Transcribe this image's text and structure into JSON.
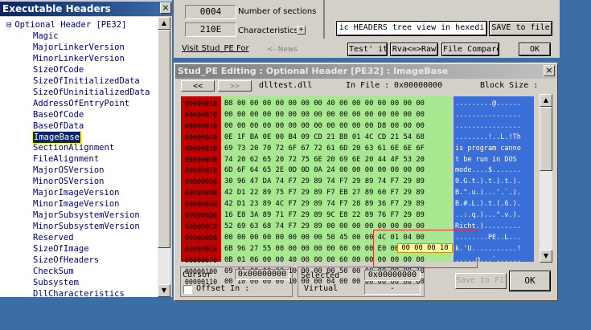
{
  "tree_window": {
    "title": "Executable Headers",
    "close": "×",
    "items": [
      {
        "prefix": "⊟",
        "label": "Optional Header [PE32]"
      },
      {
        "prefix": "",
        "label": "Magic"
      },
      {
        "prefix": "",
        "label": "MajorLinkerVersion"
      },
      {
        "prefix": "",
        "label": "MinorLinkerVersion"
      },
      {
        "prefix": "",
        "label": "SizeOfCode"
      },
      {
        "prefix": "",
        "label": "SizeOfInitializedData"
      },
      {
        "prefix": "",
        "label": "SizeOfUninitializedData"
      },
      {
        "prefix": "",
        "label": "AddressOfEntryPoint"
      },
      {
        "prefix": "",
        "label": "BaseOfCode"
      },
      {
        "prefix": "",
        "label": "BaseOfData"
      },
      {
        "prefix": "",
        "label": "ImageBase",
        "selected": true
      },
      {
        "prefix": "",
        "label": "SectionAlignment"
      },
      {
        "prefix": "",
        "label": "FileAlignment"
      },
      {
        "prefix": "",
        "label": "MajorOSVersion"
      },
      {
        "prefix": "",
        "label": "MinorOSVersion"
      },
      {
        "prefix": "",
        "label": "MajorImageVersion"
      },
      {
        "prefix": "",
        "label": "MinorImageVersion"
      },
      {
        "prefix": "",
        "label": "MajorSubsystemVersion"
      },
      {
        "prefix": "",
        "label": "MinorSubsystemVersion"
      },
      {
        "prefix": "",
        "label": "Reserved"
      },
      {
        "prefix": "",
        "label": "SizeOfImage"
      },
      {
        "prefix": "",
        "label": "SizeOfHeaders"
      },
      {
        "prefix": "",
        "label": "CheckSum"
      },
      {
        "prefix": "",
        "label": "Subsystem"
      },
      {
        "prefix": "",
        "label": "DllCharacteristics"
      }
    ]
  },
  "top_area": {
    "num_sections_value": "0004",
    "num_sections_label": "Number of sections",
    "characteristics_value": "210E",
    "characteristics_label": "Characteristics",
    "characteristics_btn": "+",
    "visit_label": "Visit Stud_PE For",
    "news_label": "<- News",
    "headers_hex_btn": "ic HEADERS tree view in hexedi",
    "save_btn": "SAVE to file",
    "test_btn": "Test' it",
    "rva_raw_btn": "Rva<=>Raw",
    "file_compare_btn": "File Compare",
    "ok_btn": "OK"
  },
  "editor": {
    "title": "Stud_PE Editing : Optional Header [PE32] : ImageBase",
    "close": "×",
    "prev_btn": "<<",
    "next_btn": ">>",
    "filename": "dlltest.dll",
    "in_file_label": "In File :",
    "in_file_value": "0x00000000",
    "block_size_label": "Block Size :",
    "offsets": [
      "00000010",
      "00000020",
      "00000030",
      "00000040",
      "00000050",
      "00000060",
      "00000070",
      "00000080",
      "00000090",
      "000000A0",
      "000000B0",
      "000000C0",
      "000000D0",
      "000000E0",
      "000000F0",
      "00000100",
      "00000110"
    ],
    "hex_rows": [
      "B8 00 00 00 00 00 00 00 40 00 00 00 00 00 00 00",
      "00 00 00 00 00 00 00 00 00 00 00 00 00 00 00 00",
      "00 00 00 00 00 00 00 00 00 00 00 00 D8 00 00 00",
      "0E 1F BA 0E 00 B4 09 CD 21 B8 01 4C CD 21 54 68",
      "69 73 20 70 72 6F 67 72 61 6D 20 63 61 6E 6E 6F",
      "74 20 62 65 20 72 75 6E 20 69 6E 20 44 4F 53 20",
      "6D 6F 64 65 2E 0D 0D 0A 24 00 00 00 00 00 00 00",
      "30 96 47 DA 74 F7 29 89 74 F7 29 89 74 F7 29 89",
      "42 D1 22 89 75 F7 29 89 F7 EB 27 89 60 F7 29 89",
      "42 D1 23 89 4C F7 29 89 74 F7 28 89 36 F7 29 89",
      "16 E8 3A 89 71 F7 29 89 9C E8 22 89 76 F7 29 89",
      "52 69 63 68 74 F7 29 89 00 00 00 00 00 00 00 00",
      "00 00 00 00 00 00 00 00 50 45 00 00 4C 01 04 00",
      "6B 96 27 55 00 00 00 00 00 00 00 00 E0 00 0E 21",
      "0B 01 06 00 00 40 00 00 00 60 00 00 00 00 00 00",
      "09 11 00 00 00 10 00 00 00 50 00 00 00 00 00 10",
      "00 10 00 00 00 10 00 00 04 00 00 00 00 00 00 00"
    ],
    "ascii_rows": [
      ".........@......",
      "................",
      "................",
      "........!..L.!Th",
      "is program canno",
      "t be run in DOS ",
      "mode....$.......",
      "0.G.t.).t.).t.).",
      "B.\".u.)...'.`.).",
      "B.#.L.).t.(.6.).",
      "..:.q.)...\".v.).",
      "Richt.).........",
      "........PE..L...",
      "k.'U...........!",
      ".....@...`......",
      ".........P......",
      "................"
    ],
    "highlight_value": "00 00 00 10",
    "cursor_label": "Cursor",
    "cursor_value": "0x00000000",
    "offset_in_label": "Offset In :",
    "selected_label": "Selected",
    "selected_value": "0x00000000",
    "virtual_label": "Virtual",
    "virtual_value": "-",
    "save_to_file_btn": "Save to File",
    "ok_btn": "OK"
  },
  "colors": {
    "offset_bg": "#c00000",
    "hex_bg": "#a8e890",
    "ascii_bg": "#3a6ed8",
    "tree_text": "#00007b",
    "desktop": "#3a6ea5"
  }
}
